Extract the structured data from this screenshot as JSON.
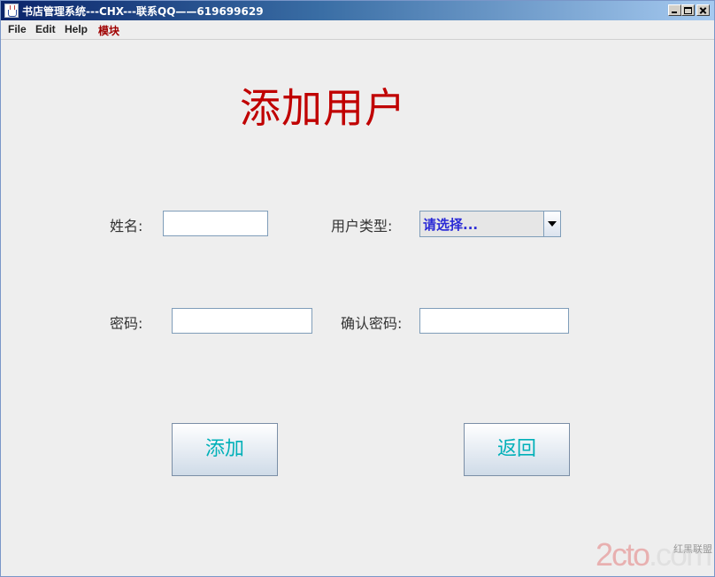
{
  "window": {
    "title": "书店管理系统---CHX---联系QQ——619699629",
    "title_color": "#ffffff"
  },
  "menubar": {
    "items": [
      "File",
      "Edit",
      "Help",
      "模块"
    ]
  },
  "form": {
    "heading": "添加用户",
    "heading_color": "#c00000",
    "name_label": "姓名:",
    "name_value": "",
    "user_type_label": "用户类型:",
    "user_type_selected": "请选择...",
    "password_label": "密码:",
    "password_value": "",
    "confirm_password_label": "确认密码:",
    "confirm_password_value": "",
    "add_button": "添加",
    "back_button": "返回",
    "button_text_color": "#00b0b8"
  },
  "watermark": {
    "main": "2cto",
    "suffix": ".com",
    "side": "红黑联盟"
  }
}
